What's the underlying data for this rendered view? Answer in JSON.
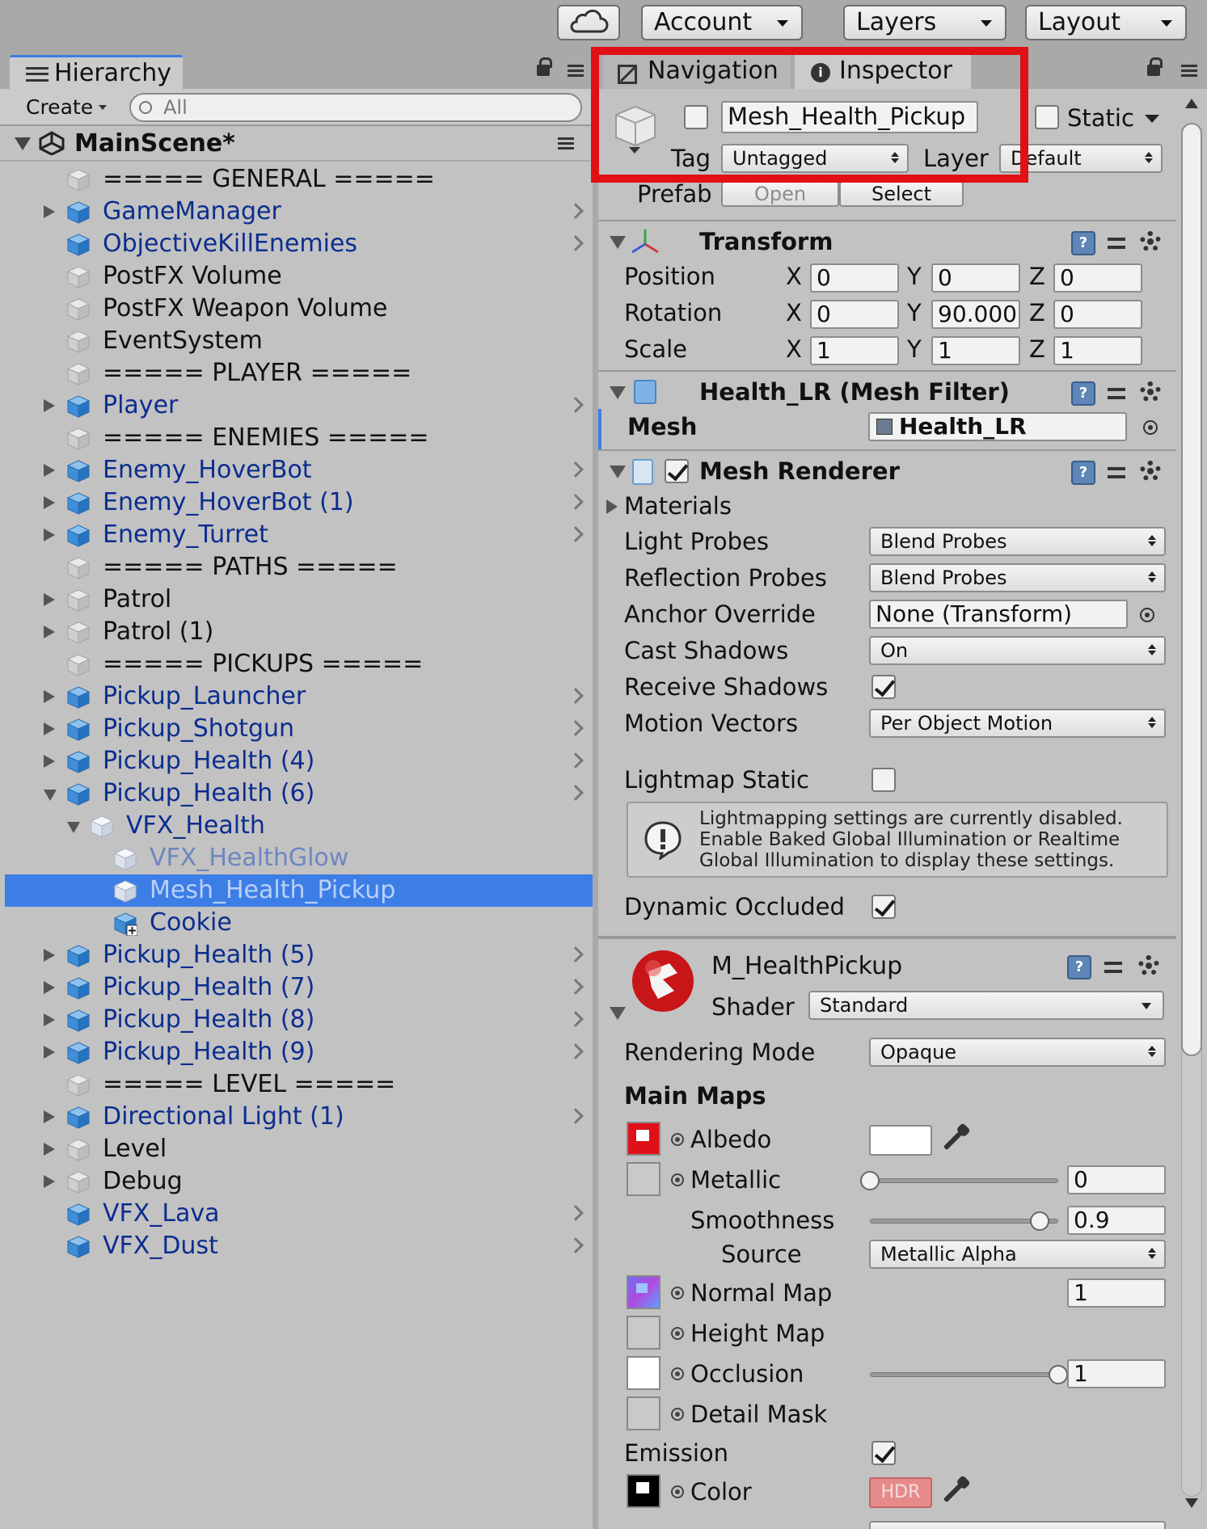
{
  "toolbar": {
    "cloud_icon": "cloud-icon",
    "account_label": "Account",
    "layers_label": "Layers",
    "layout_label": "Layout"
  },
  "hierarchy": {
    "tab_label": "Hierarchy",
    "create_label": "Create",
    "search_placeholder": "All",
    "scene_name": "MainScene*",
    "items": [
      {
        "label": "===== GENERAL =====",
        "depth": 0,
        "expander": "none",
        "icon": "gray",
        "link": false
      },
      {
        "label": "GameManager",
        "depth": 0,
        "expander": "closed",
        "icon": "blue",
        "link": true
      },
      {
        "label": "ObjectiveKillEnemies",
        "depth": 0,
        "expander": "none",
        "icon": "blue",
        "link": true
      },
      {
        "label": "PostFX Volume",
        "depth": 0,
        "expander": "none",
        "icon": "gray",
        "link": false
      },
      {
        "label": "PostFX Weapon Volume",
        "depth": 0,
        "expander": "none",
        "icon": "gray",
        "link": false
      },
      {
        "label": "EventSystem",
        "depth": 0,
        "expander": "none",
        "icon": "gray",
        "link": false
      },
      {
        "label": "===== PLAYER =====",
        "depth": 0,
        "expander": "none",
        "icon": "gray",
        "link": false
      },
      {
        "label": "Player",
        "depth": 0,
        "expander": "closed",
        "icon": "blue",
        "link": true
      },
      {
        "label": "===== ENEMIES =====",
        "depth": 0,
        "expander": "none",
        "icon": "gray",
        "link": false
      },
      {
        "label": "Enemy_HoverBot",
        "depth": 0,
        "expander": "closed",
        "icon": "blue",
        "link": true
      },
      {
        "label": "Enemy_HoverBot (1)",
        "depth": 0,
        "expander": "closed",
        "icon": "blue",
        "link": true
      },
      {
        "label": "Enemy_Turret",
        "depth": 0,
        "expander": "closed",
        "icon": "blue",
        "link": true
      },
      {
        "label": "===== PATHS =====",
        "depth": 0,
        "expander": "none",
        "icon": "gray",
        "link": false
      },
      {
        "label": "Patrol",
        "depth": 0,
        "expander": "closed",
        "icon": "gray",
        "link": false
      },
      {
        "label": "Patrol (1)",
        "depth": 0,
        "expander": "closed",
        "icon": "gray",
        "link": false
      },
      {
        "label": "===== PICKUPS =====",
        "depth": 0,
        "expander": "none",
        "icon": "gray",
        "link": false
      },
      {
        "label": "Pickup_Launcher",
        "depth": 0,
        "expander": "closed",
        "icon": "blue",
        "link": true
      },
      {
        "label": "Pickup_Shotgun",
        "depth": 0,
        "expander": "closed",
        "icon": "blue",
        "link": true
      },
      {
        "label": "Pickup_Health (4)",
        "depth": 0,
        "expander": "closed",
        "icon": "blue",
        "link": true
      },
      {
        "label": "Pickup_Health (6)",
        "depth": 0,
        "expander": "open",
        "icon": "blue",
        "link": true
      },
      {
        "label": "VFX_Health",
        "depth": 1,
        "expander": "open",
        "icon": "white",
        "link": true
      },
      {
        "label": "VFX_HealthGlow",
        "depth": 2,
        "expander": "none",
        "icon": "white",
        "link": true,
        "faded": true
      },
      {
        "label": "Mesh_Health_Pickup",
        "depth": 2,
        "expander": "none",
        "icon": "white",
        "link": true,
        "selected": true
      },
      {
        "label": "Cookie",
        "depth": 2,
        "expander": "none",
        "icon": "blue-plus",
        "link": true
      },
      {
        "label": "Pickup_Health (5)",
        "depth": 0,
        "expander": "closed",
        "icon": "blue",
        "link": true
      },
      {
        "label": "Pickup_Health (7)",
        "depth": 0,
        "expander": "closed",
        "icon": "blue",
        "link": true
      },
      {
        "label": "Pickup_Health (8)",
        "depth": 0,
        "expander": "closed",
        "icon": "blue",
        "link": true
      },
      {
        "label": "Pickup_Health (9)",
        "depth": 0,
        "expander": "closed",
        "icon": "blue",
        "link": true
      },
      {
        "label": "===== LEVEL =====",
        "depth": 0,
        "expander": "none",
        "icon": "gray",
        "link": false
      },
      {
        "label": "Directional Light (1)",
        "depth": 0,
        "expander": "closed",
        "icon": "blue",
        "link": true
      },
      {
        "label": "Level",
        "depth": 0,
        "expander": "closed",
        "icon": "gray",
        "link": false
      },
      {
        "label": "Debug",
        "depth": 0,
        "expander": "closed",
        "icon": "gray",
        "link": false
      },
      {
        "label": "VFX_Lava",
        "depth": 0,
        "expander": "none",
        "icon": "blue",
        "link": true
      },
      {
        "label": "VFX_Dust",
        "depth": 0,
        "expander": "none",
        "icon": "blue",
        "link": true
      }
    ]
  },
  "inspector": {
    "nav_tab_label": "Navigation",
    "inspector_tab_label": "Inspector",
    "object_name": "Mesh_Health_Pickup",
    "static_label": "Static",
    "tag_label": "Tag",
    "tag_value": "Untagged",
    "layer_label": "Layer",
    "layer_value": "Default",
    "prefab_label": "Prefab",
    "open_label": "Open",
    "select_label": "Select",
    "transform": {
      "title": "Transform",
      "position_label": "Position",
      "rotation_label": "Rotation",
      "scale_label": "Scale",
      "x": "X",
      "y": "Y",
      "z": "Z",
      "position": [
        "0",
        "0",
        "0"
      ],
      "rotation": [
        "0",
        "90.000",
        "0"
      ],
      "scale": [
        "1",
        "1",
        "1"
      ]
    },
    "mesh_filter": {
      "title": "Health_LR (Mesh Filter)",
      "mesh_label": "Mesh",
      "mesh_value": "Health_LR"
    },
    "mesh_renderer": {
      "title": "Mesh Renderer",
      "materials_label": "Materials",
      "light_probes_label": "Light Probes",
      "light_probes_value": "Blend Probes",
      "reflection_probes_label": "Reflection Probes",
      "reflection_probes_value": "Blend Probes",
      "anchor_override_label": "Anchor Override",
      "anchor_override_value": "None (Transform)",
      "cast_shadows_label": "Cast Shadows",
      "cast_shadows_value": "On",
      "receive_shadows_label": "Receive Shadows",
      "motion_vectors_label": "Motion Vectors",
      "motion_vectors_value": "Per Object Motion",
      "lightmap_static_label": "Lightmap Static",
      "lightmap_info_1": "Lightmapping settings are currently disabled.",
      "lightmap_info_2": "Enable Baked Global Illumination or Realtime",
      "lightmap_info_3": "Global Illumination to display these settings.",
      "dynamic_occluded_label": "Dynamic Occluded"
    },
    "material": {
      "name": "M_HealthPickup",
      "shader_label": "Shader",
      "shader_value": "Standard",
      "rendering_mode_label": "Rendering Mode",
      "rendering_mode_value": "Opaque",
      "main_maps_label": "Main Maps",
      "albedo_label": "Albedo",
      "metallic_label": "Metallic",
      "metallic_value": "0",
      "metallic_level": 0,
      "smoothness_label": "Smoothness",
      "smoothness_value": "0.9",
      "smoothness_level": 0.9,
      "source_label": "Source",
      "source_value": "Metallic Alpha",
      "normal_map_label": "Normal Map",
      "normal_map_value": "1",
      "height_map_label": "Height Map",
      "occlusion_label": "Occlusion",
      "occlusion_value": "1",
      "occlusion_level": 1,
      "detail_mask_label": "Detail Mask",
      "emission_label": "Emission",
      "color_label": "Color",
      "hdr_label": "HDR"
    }
  },
  "colors": {
    "selection": "#3d7ee6",
    "link_text": "#0c2d8f",
    "highlight_box": "#e01016"
  }
}
